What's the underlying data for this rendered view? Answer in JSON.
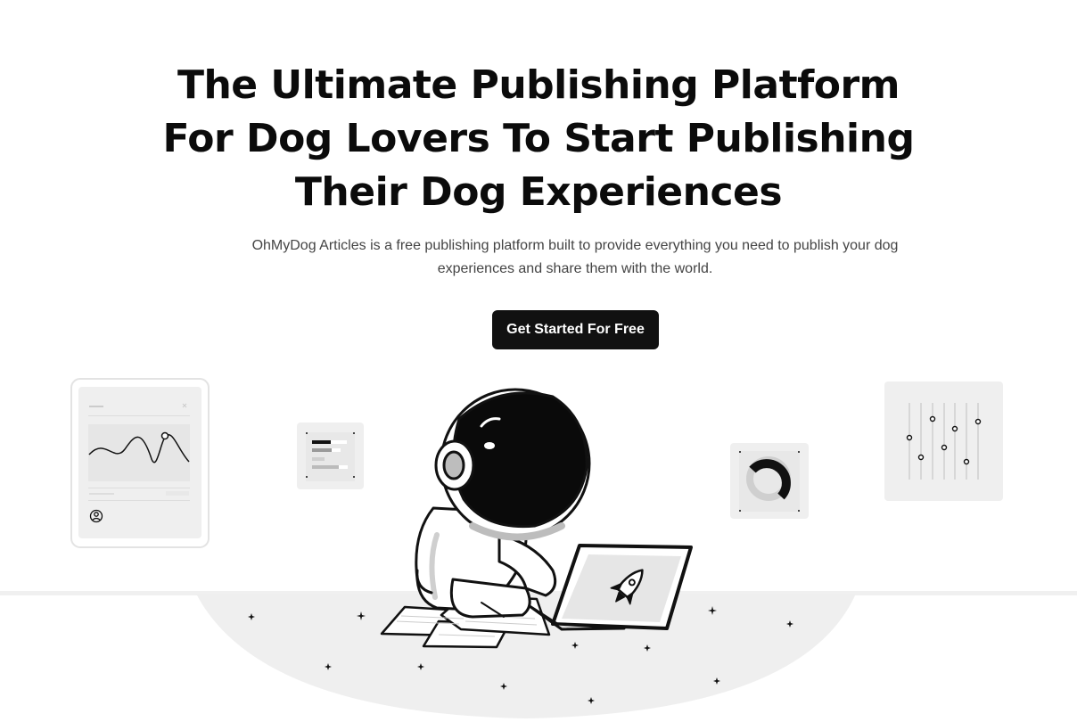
{
  "hero": {
    "title_lines": [
      "The Ultimate Publishing Platform",
      "For Dog Lovers To Start Publishing",
      "Their Dog Experiences"
    ],
    "subtitle": "OhMyDog Articles is a free publishing platform built to provide everything you need to publish your dog experiences and share them with the world.",
    "cta_label": "Get Started For Free"
  },
  "illustration": {
    "character": "astronaut-icon",
    "laptop_logo": "rocket-icon",
    "widgets": [
      "line-chart-card",
      "text-bars-card",
      "donut-chart-card",
      "sliders-card"
    ],
    "profile_icon": "user-icon"
  },
  "colors": {
    "background": "#ffffff",
    "primary_text": "#0b0b0b",
    "button_bg": "#111111",
    "button_text": "#ffffff",
    "card_bg": "#f0f0f0",
    "ground": "#f0f0f0"
  }
}
